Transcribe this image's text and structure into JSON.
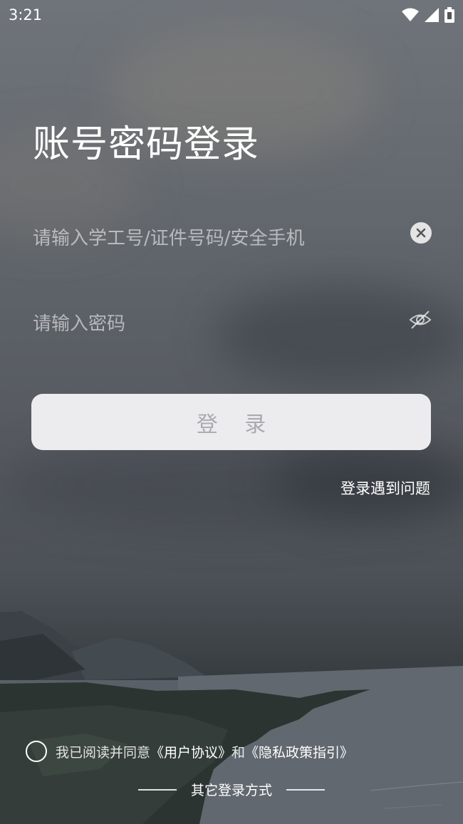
{
  "status_bar": {
    "time": "3:21",
    "icons": [
      "wifi-icon",
      "signal-icon",
      "battery-icon"
    ]
  },
  "login": {
    "title": "账号密码登录",
    "username_placeholder": "请输入学工号/证件号码/安全手机",
    "password_placeholder": "请输入密码",
    "login_button": "登 录",
    "help_link": "登录遇到问题"
  },
  "agreement": {
    "prefix": "我已阅读并同意",
    "user_agreement": "《用户协议》",
    "conjunction": "和",
    "privacy_policy": "《隐私政策指引》",
    "checked": false
  },
  "other_login": {
    "label": "其它登录方式"
  },
  "colors": {
    "button_bg": "#ececee",
    "button_text": "#a9abaf",
    "text": "#ffffff"
  }
}
